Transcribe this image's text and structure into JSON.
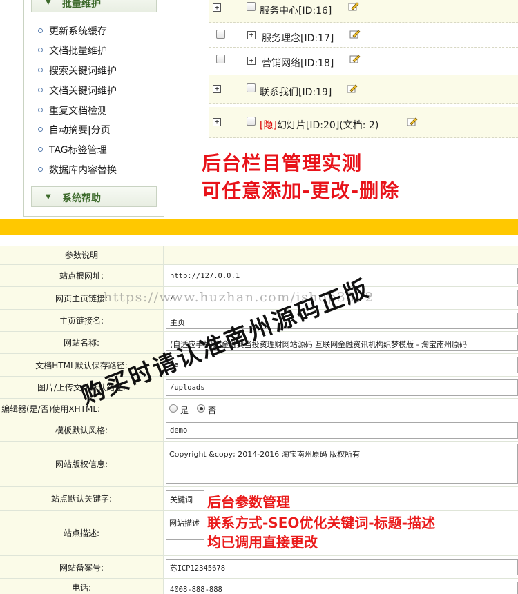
{
  "sidebar": {
    "section1_title": "批量维护",
    "items": [
      {
        "label": "更新系统缓存"
      },
      {
        "label": "文档批量维护"
      },
      {
        "label": "搜索关键词维护"
      },
      {
        "label": "文档关键词维护"
      },
      {
        "label": "重复文档检测"
      },
      {
        "label": "自动摘要|分页"
      },
      {
        "label": "TAG标签管理"
      },
      {
        "label": "数据库内容替换"
      }
    ],
    "section2_title": "系统帮助"
  },
  "tree": {
    "rows": [
      {
        "label": "服务中心[ID:16]"
      },
      {
        "label": "服务理念[ID:17]"
      },
      {
        "label": "营销网络[ID:18]"
      },
      {
        "label": "联系我们[ID:19]"
      },
      {
        "hidden_tag": "[隐]",
        "label": "幻灯片[ID:20](文档: 2)"
      }
    ]
  },
  "banner_top": {
    "line1": "后台栏目管理实测",
    "line2": "可任意添加-更改-删除"
  },
  "settings": {
    "header": "参数说明",
    "rows": [
      {
        "label": "站点根网址:",
        "value": "http://127.0.0.1"
      },
      {
        "label": "网页主页链接:",
        "value": "/"
      },
      {
        "label": "主页链接名:",
        "value": "主页"
      },
      {
        "label": "网站名称:",
        "value": "(自适应手机版)金融典当投资理财网站源码 互联网金融资讯机构织梦模版 - 淘宝南州原码"
      },
      {
        "label": "文档HTML默认保存路径:",
        "value": "/a"
      },
      {
        "label": "图片/上传文件默认路径:",
        "value": "/uploads"
      },
      {
        "label": "编辑器(是/否)使用XHTML:",
        "opt_yes": "是",
        "opt_no": "否"
      },
      {
        "label": "模板默认风格:",
        "value": "demo"
      },
      {
        "label": "网站版权信息:",
        "value": "Copyright &copy; 2014-2016 淘宝南州原码 版权所有"
      },
      {
        "label": "站点默认关键字:",
        "value": "关键词"
      },
      {
        "label": "站点描述:",
        "value": "网站描述"
      },
      {
        "label": "网站备案号:",
        "value": "苏ICP12345678"
      },
      {
        "label": "电话:",
        "value": "4008-888-888"
      }
    ]
  },
  "overlays": {
    "watermark_url": "https://www.huzhan.com/ishop3572",
    "handwritten_notice": "购买时请认准南州源码正版",
    "red_title": "后台参数管理",
    "red_line1": "联系方式-SEO优化关键词-标题-描述",
    "red_line2": "均已调用直接更改"
  },
  "colors": {
    "accent_red": "#e8131a",
    "yellow_bar": "#ffc800",
    "label_bg": "#fbfbe8",
    "sidebar_green": "#3d6a2c"
  }
}
